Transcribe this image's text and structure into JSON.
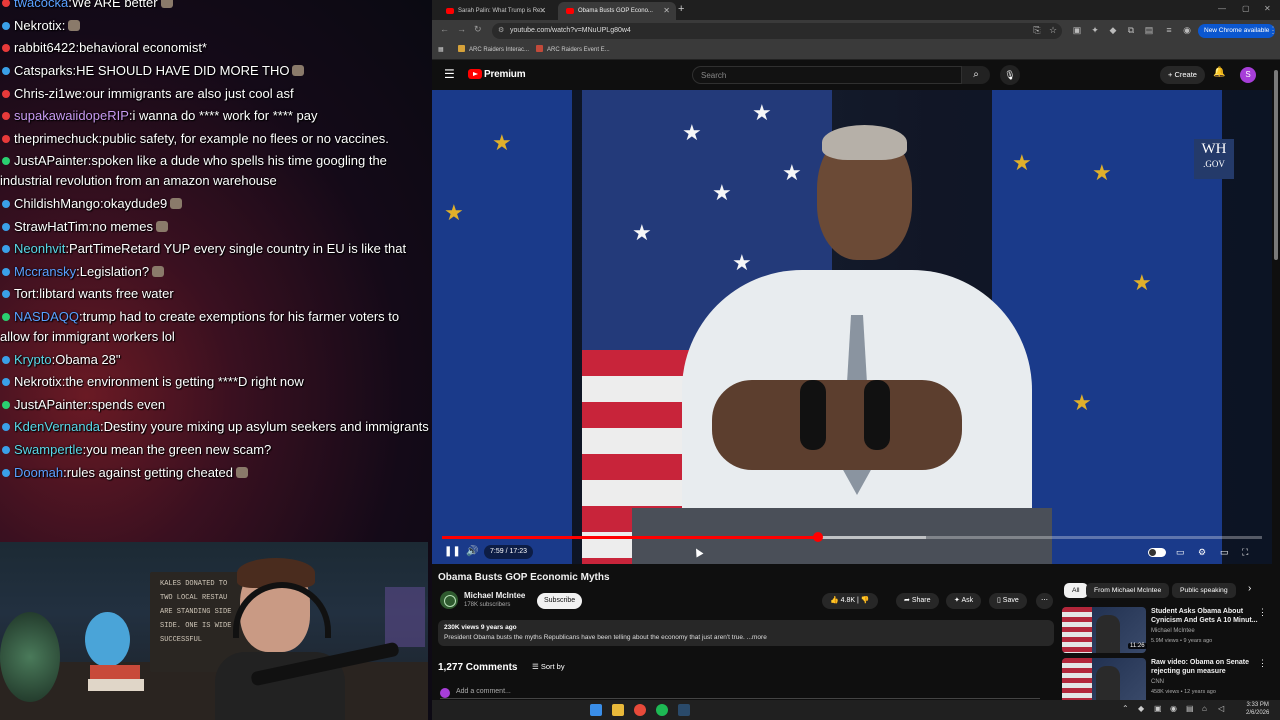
{
  "chat": {
    "messages": [
      {
        "user": "twacocka",
        "text": "We ARE better",
        "color": "#5aa0ff",
        "badge": "#e83a3a",
        "emote": true
      },
      {
        "user": "Nekrotix",
        "text": "",
        "color": "#ffffff",
        "badge": "#3aa0e8",
        "emote": true
      },
      {
        "user": "rabbit6422",
        "text": "behavioral economist*",
        "color": "#ffffff",
        "badge": "#e83a3a",
        "emote": false
      },
      {
        "user": "Catsparks",
        "text": "HE SHOULD HAVE DID MORE THO",
        "color": "#ffffff",
        "badge": "#3aa0e8",
        "emote": true
      },
      {
        "user": "Chris-zi1we",
        "text": "our immigrants are also just cool asf",
        "color": "#ffffff",
        "badge": "#e83a3a",
        "emote": false
      },
      {
        "user": "supakawaiidopeRIP",
        "text": "i wanna do **** work for **** pay",
        "color": "#c89af0",
        "badge": "#e83a3a",
        "emote": false
      },
      {
        "user": "theprimechuck",
        "text": "public safety, for example no flees or no vaccines.",
        "color": "#ffffff",
        "badge": "#e83a3a",
        "emote": false
      },
      {
        "user": "JustAPainter",
        "text": "spoken like a dude who spells his time googling the industrial revolution from an amazon warehouse",
        "color": "#ffffff",
        "badge": "#2ad070",
        "emote": false
      },
      {
        "user": "ChildishMango",
        "text": "okaydude9",
        "color": "#ffffff",
        "badge": "#3aa0e8",
        "emote": true
      },
      {
        "user": "StrawHatTim",
        "text": "no memes",
        "color": "#ffffff",
        "badge": "#3aa0e8",
        "emote": true
      },
      {
        "user": "Neonhvit",
        "text": "PartTimeRetard YUP every single country in EU is like that",
        "color": "#5ad8e8",
        "badge": "#3aa0e8",
        "emote": false
      },
      {
        "user": "Mccransky",
        "text": "Legislation?",
        "color": "#5aa0ff",
        "badge": "#3aa0e8",
        "emote": true
      },
      {
        "user": "Tort",
        "text": "libtard wants free water",
        "color": "#ffffff",
        "badge": "#3aa0e8",
        "emote": false
      },
      {
        "user": "NASDAQQ",
        "text": "trump had to create exemptions for his farmer voters to allow for immigrant workers lol",
        "color": "#5aa0ff",
        "badge": "#2ad070",
        "emote": false
      },
      {
        "user": "Krypto",
        "text": "Obama 28\"",
        "color": "#5ad8e8",
        "badge": "#3aa0e8",
        "emote": false
      },
      {
        "user": "Nekrotix",
        "text": "the environment is getting ****D right now",
        "color": "#ffffff",
        "badge": "#3aa0e8",
        "emote": false
      },
      {
        "user": "JustAPainter",
        "text": "spends even",
        "color": "#ffffff",
        "badge": "#2ad070",
        "emote": false
      },
      {
        "user": "KdenVernanda",
        "text": "Destiny youre mixing up asylum seekers and immigrants",
        "color": "#5ad8e8",
        "badge": "#3aa0e8",
        "emote": false
      },
      {
        "user": "Swampertle",
        "text": "you mean the green new scam?",
        "color": "#5ad8e8",
        "badge": "#3aa0e8",
        "emote": false
      },
      {
        "user": "Doomah",
        "text": "rules against getting cheated",
        "color": "#5aa0ff",
        "badge": "#3aa0e8",
        "emote": true
      }
    ]
  },
  "webcam": {
    "sign_lines": [
      "KALES DONATED TO",
      "TWO LOCAL RESTAU",
      "ARE STANDING SIDE",
      "SIDE. ONE IS WIDE",
      "SUCCESSFUL"
    ]
  },
  "browser": {
    "tabs": [
      {
        "title": "Sarah Palin: What Trump is Re..."
      },
      {
        "title": "Obama Busts GOP Econo..."
      }
    ],
    "url": "youtube.com/watch?v=MNuUPLg80w4",
    "bookmarks": [
      "ARC Raiders Interac...",
      "ARC Raiders Event E..."
    ],
    "new_chrome": "New Chrome available"
  },
  "youtube": {
    "brand": "Premium",
    "search_placeholder": "Search",
    "create_label": "Create",
    "avatar_letter": "S",
    "player": {
      "time": "7:59 / 17:23",
      "progress": 0.459,
      "buffered": 0.59,
      "wh_logo_top": "WH",
      "wh_logo_bottom": ".GOV"
    },
    "video": {
      "title": "Obama Busts GOP Economic Myths",
      "channel": "Michael McIntee",
      "subscribers": "178K subscribers",
      "subscribe_label": "Subscribe",
      "likes": "4.8K",
      "share_label": "Share",
      "ask_label": "Ask",
      "save_label": "Save",
      "meta": "230K views  9 years ago",
      "description": "President Obama busts the myths Republicans have been telling about the economy that just aren't true. ...more",
      "comments_count": "1,277 Comments",
      "sort_label": "Sort by",
      "add_comment": "Add a comment..."
    },
    "chips": [
      "All",
      "From Michael McIntee",
      "Public speaking"
    ],
    "related": [
      {
        "title": "Student Asks Obama About Cynicism And Gets A 10 Minut...",
        "channel": "Michael McIntee",
        "meta": "5.9M views • 9 years ago",
        "duration": "11:26"
      },
      {
        "title": "Raw video: Obama on Senate rejecting gun measure",
        "channel": "CNN",
        "meta": "458K views • 12 years ago",
        "duration": ""
      }
    ]
  },
  "taskbar": {
    "time": "3:33 PM",
    "date": "2/6/2026"
  }
}
